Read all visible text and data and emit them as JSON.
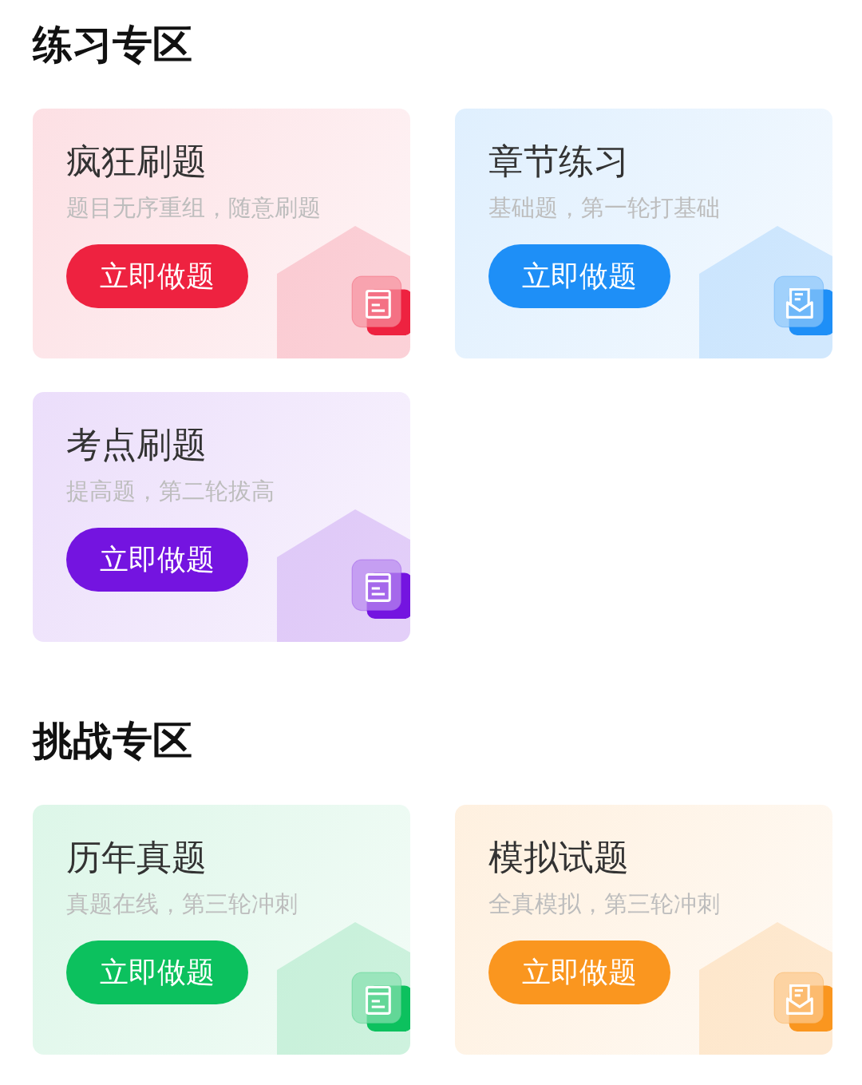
{
  "sections": [
    {
      "title": "练习专区",
      "cards": [
        {
          "title": "疯狂刷题",
          "subtitle": "题目无序重组，随意刷题",
          "button": "立即做题",
          "color": "#ee2240"
        },
        {
          "title": "章节练习",
          "subtitle": "基础题，第一轮打基础",
          "button": "立即做题",
          "color": "#1e8ff7"
        },
        {
          "title": "考点刷题",
          "subtitle": "提高题，第二轮拔高",
          "button": "立即做题",
          "color": "#7414e0"
        }
      ]
    },
    {
      "title": "挑战专区",
      "cards": [
        {
          "title": "历年真题",
          "subtitle": "真题在线，第三轮冲刺",
          "button": "立即做题",
          "color": "#0cc15e"
        },
        {
          "title": "模拟试题",
          "subtitle": "全真模拟，第三轮冲刺",
          "button": "立即做题",
          "color": "#fa961f"
        }
      ]
    }
  ]
}
